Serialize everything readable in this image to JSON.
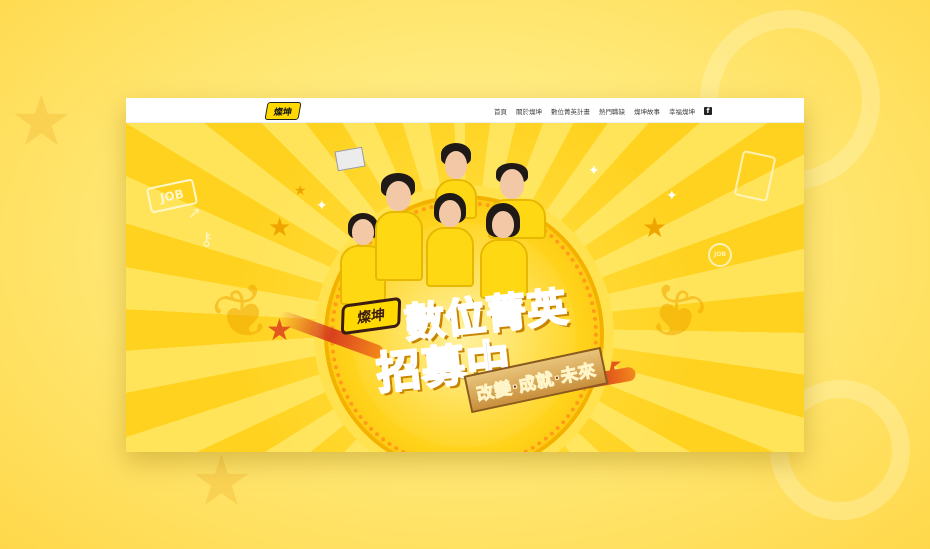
{
  "nav": {
    "logo_text": "燦坤",
    "items": [
      {
        "label": "首頁"
      },
      {
        "label": "關於燦坤"
      },
      {
        "label": "數位菁英計畫"
      },
      {
        "label": "熱門職缺"
      },
      {
        "label": "燦坤故事"
      },
      {
        "label": "幸福燦坤"
      }
    ],
    "facebook_icon": "f"
  },
  "hero": {
    "badge_text": "燦坤",
    "title_line1": "數位菁英",
    "title_line2": "招募中",
    "ribbon_text": "改變‧成就‧未來",
    "job_tag": "JOB",
    "job_search": "JOB"
  },
  "colors": {
    "brand_yellow": "#ffd900",
    "title_brown": "#5a2a14",
    "accent_orange": "#f5b100"
  }
}
